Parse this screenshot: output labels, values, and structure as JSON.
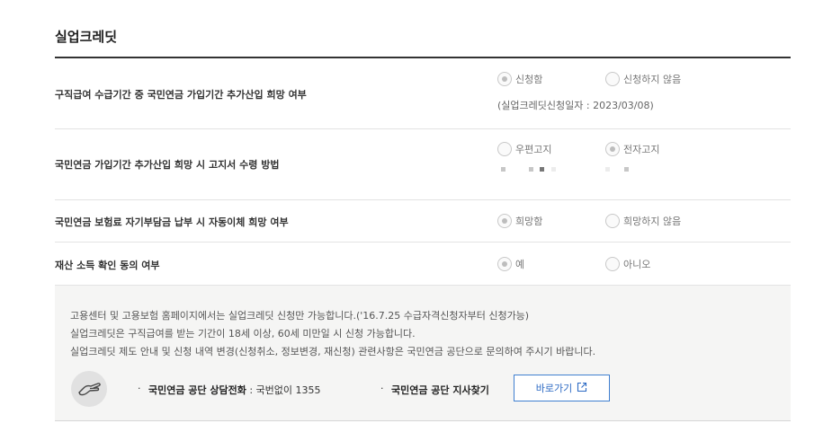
{
  "section": {
    "title": "실업크레딧"
  },
  "rows": [
    {
      "label": "구직급여 수급기간 중 국민연금 가입기간 추가산입 희망 여부",
      "options": [
        {
          "label": "신청함",
          "checked": true
        },
        {
          "label": "신청하지 않음",
          "checked": false
        }
      ],
      "note": "(실업크레딧신청일자 : 2023/03/08)"
    },
    {
      "label": "국민연금 가입기간 추가산입 희망 시 고지서 수령 방법",
      "options": [
        {
          "label": "우편고지",
          "checked": false
        },
        {
          "label": "전자고지",
          "checked": true
        }
      ]
    },
    {
      "label": "국민연금 보험료 자기부담금 납부 시 자동이체 희망 여부",
      "options": [
        {
          "label": "희망함",
          "checked": true
        },
        {
          "label": "희망하지 않음",
          "checked": false
        }
      ]
    },
    {
      "label": "재산 소득 확인 동의 여부",
      "options": [
        {
          "label": "예",
          "checked": true
        },
        {
          "label": "아니오",
          "checked": false
        }
      ]
    }
  ],
  "info": {
    "lines": [
      "고용센터 및 고용보험 홈페이지에서는 실업크레딧 신청만 가능합니다.('16.7.25 수급자격신청자부터 신청가능)",
      "실업크레딧은 구직급여를 받는 기간이 18세 이상, 60세 미만일 시 신청 가능합니다.",
      "실업크레딧 제도 안내 및 신청 내역 변경(신청취소, 정보변경, 재신청) 관련사항은 국민연금 공단으로 문의하여 주시기 바랍니다."
    ],
    "contact_bullet": "·",
    "contact_label": "국민연금 공단 상담전화",
    "contact_value": " : 국번없이 1355",
    "branch_bullet": "·",
    "branch_label": "국민연금 공단 지사찾기",
    "button_label": "바로가기"
  },
  "icons": {
    "hand": "hand-icon",
    "external": "external-link-icon"
  }
}
